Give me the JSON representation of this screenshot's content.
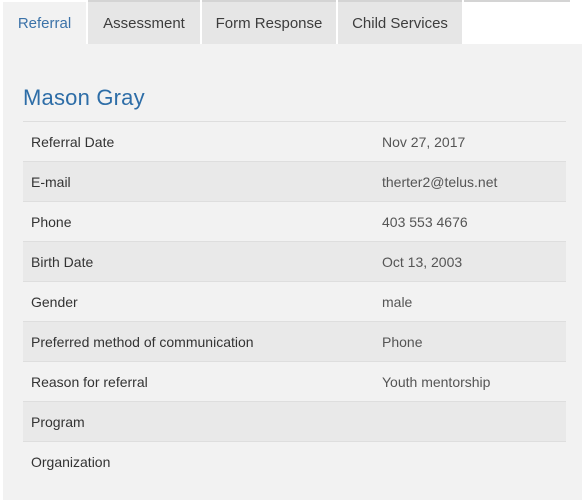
{
  "tabs": [
    {
      "label": "Referral",
      "active": true
    },
    {
      "label": "Assessment",
      "active": false
    },
    {
      "label": "Form Response",
      "active": false
    },
    {
      "label": "Child Services",
      "active": false
    }
  ],
  "person": {
    "name": "Mason Gray"
  },
  "details": [
    {
      "label": "Referral Date",
      "value": "Nov 27, 2017"
    },
    {
      "label": "E-mail",
      "value": "therter2@telus.net"
    },
    {
      "label": "Phone",
      "value": "403 553 4676"
    },
    {
      "label": "Birth Date",
      "value": "Oct 13, 2003"
    },
    {
      "label": "Gender",
      "value": "male"
    },
    {
      "label": "Preferred method of communication",
      "value": "Phone"
    },
    {
      "label": "Reason for referral",
      "value": "Youth mentorship"
    },
    {
      "label": "Program",
      "value": ""
    },
    {
      "label": "Organization",
      "value": ""
    }
  ],
  "colors": {
    "accent": "#2d6da7",
    "panel_bg": "#f2f2f2",
    "tab_bg": "#e6e6e6"
  }
}
